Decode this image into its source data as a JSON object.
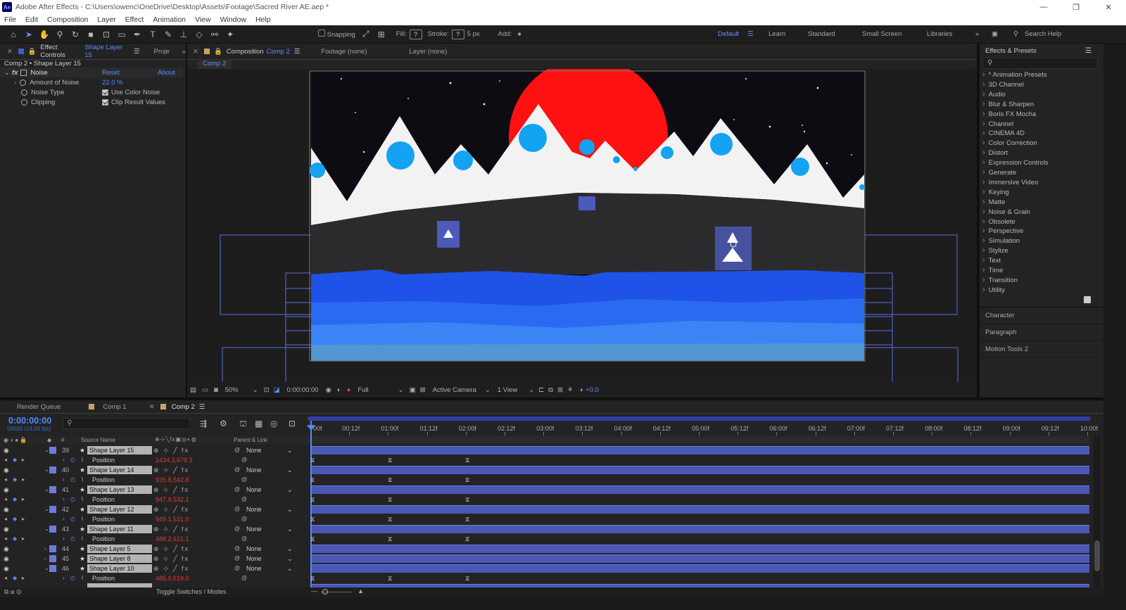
{
  "window": {
    "title": "Adobe After Effects - C:\\Users\\owenc\\OneDrive\\Desktop\\Assets\\Footage\\Sacred River AE.aep *"
  },
  "menu": [
    "File",
    "Edit",
    "Composition",
    "Layer",
    "Effect",
    "Animation",
    "View",
    "Window",
    "Help"
  ],
  "toolbar": {
    "snapping": "Snapping",
    "fill": "Fill:",
    "stroke": "Stroke:",
    "stroke_px": "5 px",
    "add": "Add:",
    "workspaces": [
      "Default",
      "Learn",
      "Standard",
      "Small Screen",
      "Libraries"
    ],
    "search_help": "Search Help"
  },
  "effect_controls": {
    "tab": "Effect Controls",
    "tab_layer": "Shape Layer 15",
    "tab_proj": "Proje",
    "header": "Comp 2 • Shape Layer 15",
    "effect_name": "Noise",
    "reset": "Reset",
    "about": "About",
    "props": [
      {
        "name": "Amount of Noise",
        "value": "22.0 %"
      },
      {
        "name": "Noise Type",
        "value": "Use Color Noise"
      },
      {
        "name": "Clipping",
        "value": "Clip Result Values"
      }
    ]
  },
  "composition": {
    "tab": "Composition",
    "tab_comp": "Comp 2",
    "footage": "Footage (none)",
    "layer": "Layer (none)",
    "subtab": "Comp 2"
  },
  "viewer": {
    "zoom": "50%",
    "time": "0:00:00:00",
    "resolution": "Full",
    "camera": "Active Camera",
    "view": "1 View",
    "exposure": "+0.0"
  },
  "effects_presets": {
    "title": "Effects & Presets",
    "categories": [
      "* Animation Presets",
      "3D Channel",
      "Audio",
      "Blur & Sharpen",
      "Boris FX Mocha",
      "Channel",
      "CINEMA 4D",
      "Color Correction",
      "Distort",
      "Expression Controls",
      "Generate",
      "Immersive Video",
      "Keying",
      "Matte",
      "Noise & Grain",
      "Obsolete",
      "Perspective",
      "Simulation",
      "Stylize",
      "Text",
      "Time",
      "Transition",
      "Utility"
    ],
    "panels": [
      "Character",
      "Paragraph",
      "Motion Tools 2"
    ]
  },
  "timeline": {
    "tabs": [
      "Render Queue",
      "Comp 1",
      "Comp 2"
    ],
    "timecode": "0:00:00:00",
    "frames": "00000 (24.00 fps)",
    "col_source": "Source Name",
    "col_parent": "Parent & Link",
    "ruler": [
      "00f",
      "00:12f",
      "01:00f",
      "01:12f",
      "02:00f",
      "02:12f",
      "03:00f",
      "03:12f",
      "04:00f",
      "04:12f",
      "05:00f",
      "05:12f",
      "06:00f",
      "06:12f",
      "07:00f",
      "07:12f",
      "08:00f",
      "08:12f",
      "09:00f",
      "09:12f",
      "10:00f"
    ],
    "layers": [
      {
        "num": "39",
        "name": "Shape Layer 15",
        "parent": "None",
        "pos": "1434.3,678.3",
        "expanded": true
      },
      {
        "num": "40",
        "name": "Shape Layer 14",
        "parent": "None",
        "pos": "935.8,542.8",
        "expanded": true
      },
      {
        "num": "41",
        "name": "Shape Layer 13",
        "parent": "None",
        "pos": "947.9,532.1",
        "expanded": true
      },
      {
        "num": "42",
        "name": "Shape Layer 12",
        "parent": "None",
        "pos": "949.1,531.0",
        "expanded": true
      },
      {
        "num": "43",
        "name": "Shape Layer 11",
        "parent": "None",
        "pos": "488.2,621.1",
        "expanded": true
      },
      {
        "num": "44",
        "name": "Shape Layer 5",
        "parent": "None"
      },
      {
        "num": "45",
        "name": "Shape Layer 8",
        "parent": "None"
      },
      {
        "num": "46",
        "name": "Shape Layer 10",
        "parent": "None",
        "pos": "486.0,619.0",
        "expanded": true
      }
    ],
    "position_label": "Position",
    "toggle": "Toggle Switches / Modes"
  },
  "colors": {
    "accent": "#5b8dff",
    "track": "#4a57b5",
    "sky": "#0c0c12",
    "sun": "#ff1111",
    "snow": "#f2f2f2",
    "water": "#1f52e6",
    "keyframe_val": "#e03838"
  }
}
